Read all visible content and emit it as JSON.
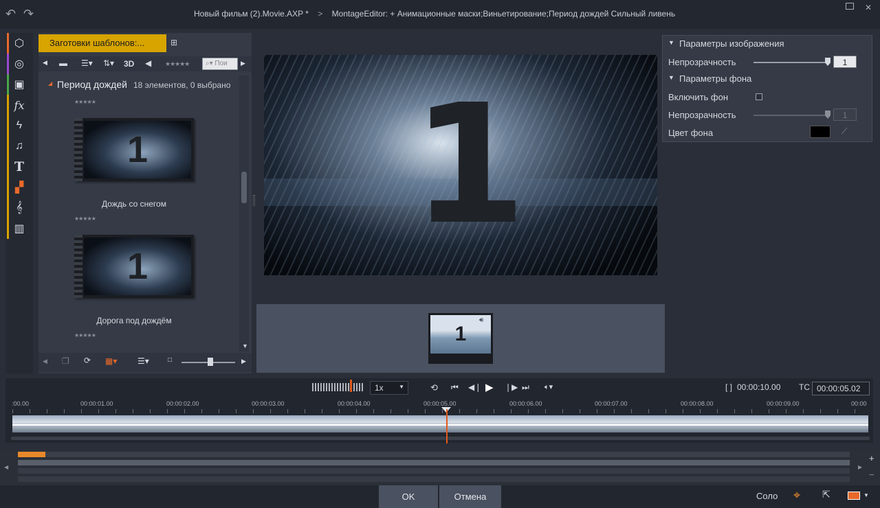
{
  "window": {
    "title_parts": [
      "Новый фильм (2).Movie.AXP",
      "*",
      ">",
      "MontageEditor: + Анимационные маски;Виньетирование;Период дождей  Сильный ливень"
    ]
  },
  "library": {
    "tab_label": "Заготовки шаблонов:...",
    "toolbar": {
      "label_3d": "3D",
      "search_placeholder": "Пои"
    },
    "group": {
      "name": "Период дождей",
      "summary": "18 элементов, 0 выбрано"
    },
    "items": [
      {
        "label": "Дождь со снегом",
        "number": "1"
      },
      {
        "label": "Дорога под дождём",
        "number": "1"
      }
    ],
    "stars": "★★★★★"
  },
  "preview": {
    "number": "1"
  },
  "strip": {
    "number": "1"
  },
  "properties": {
    "image_section": "Параметры изображения",
    "opacity_label": "Непрозрачность",
    "opacity_value": "1",
    "bg_section": "Параметры фона",
    "enable_bg_label": "Включить фон",
    "bg_opacity_label": "Непрозрачность",
    "bg_opacity_value": "1",
    "bg_color_label": "Цвет фона",
    "bg_color": "#000000"
  },
  "transport": {
    "speed": "1x",
    "duration_prefix": "[ ]",
    "duration": "00:00:10.00",
    "tc_label": "TC",
    "timecode": "00:00:05.02",
    "ticks": [
      ":00.00",
      "00:00:01.00",
      "00:00:02.00",
      "00:00:03.00",
      "00:00:04.00",
      "00:00:05.00",
      "00:00:06.00",
      "00:00:07.00",
      "00:00:08.00",
      "00:00:09.00",
      "00:00"
    ]
  },
  "bottom": {
    "ok": "OK",
    "cancel": "Отмена",
    "solo": "Соло"
  },
  "colors": {
    "accent": "#d7a400",
    "playhead": "#e05a1c"
  }
}
